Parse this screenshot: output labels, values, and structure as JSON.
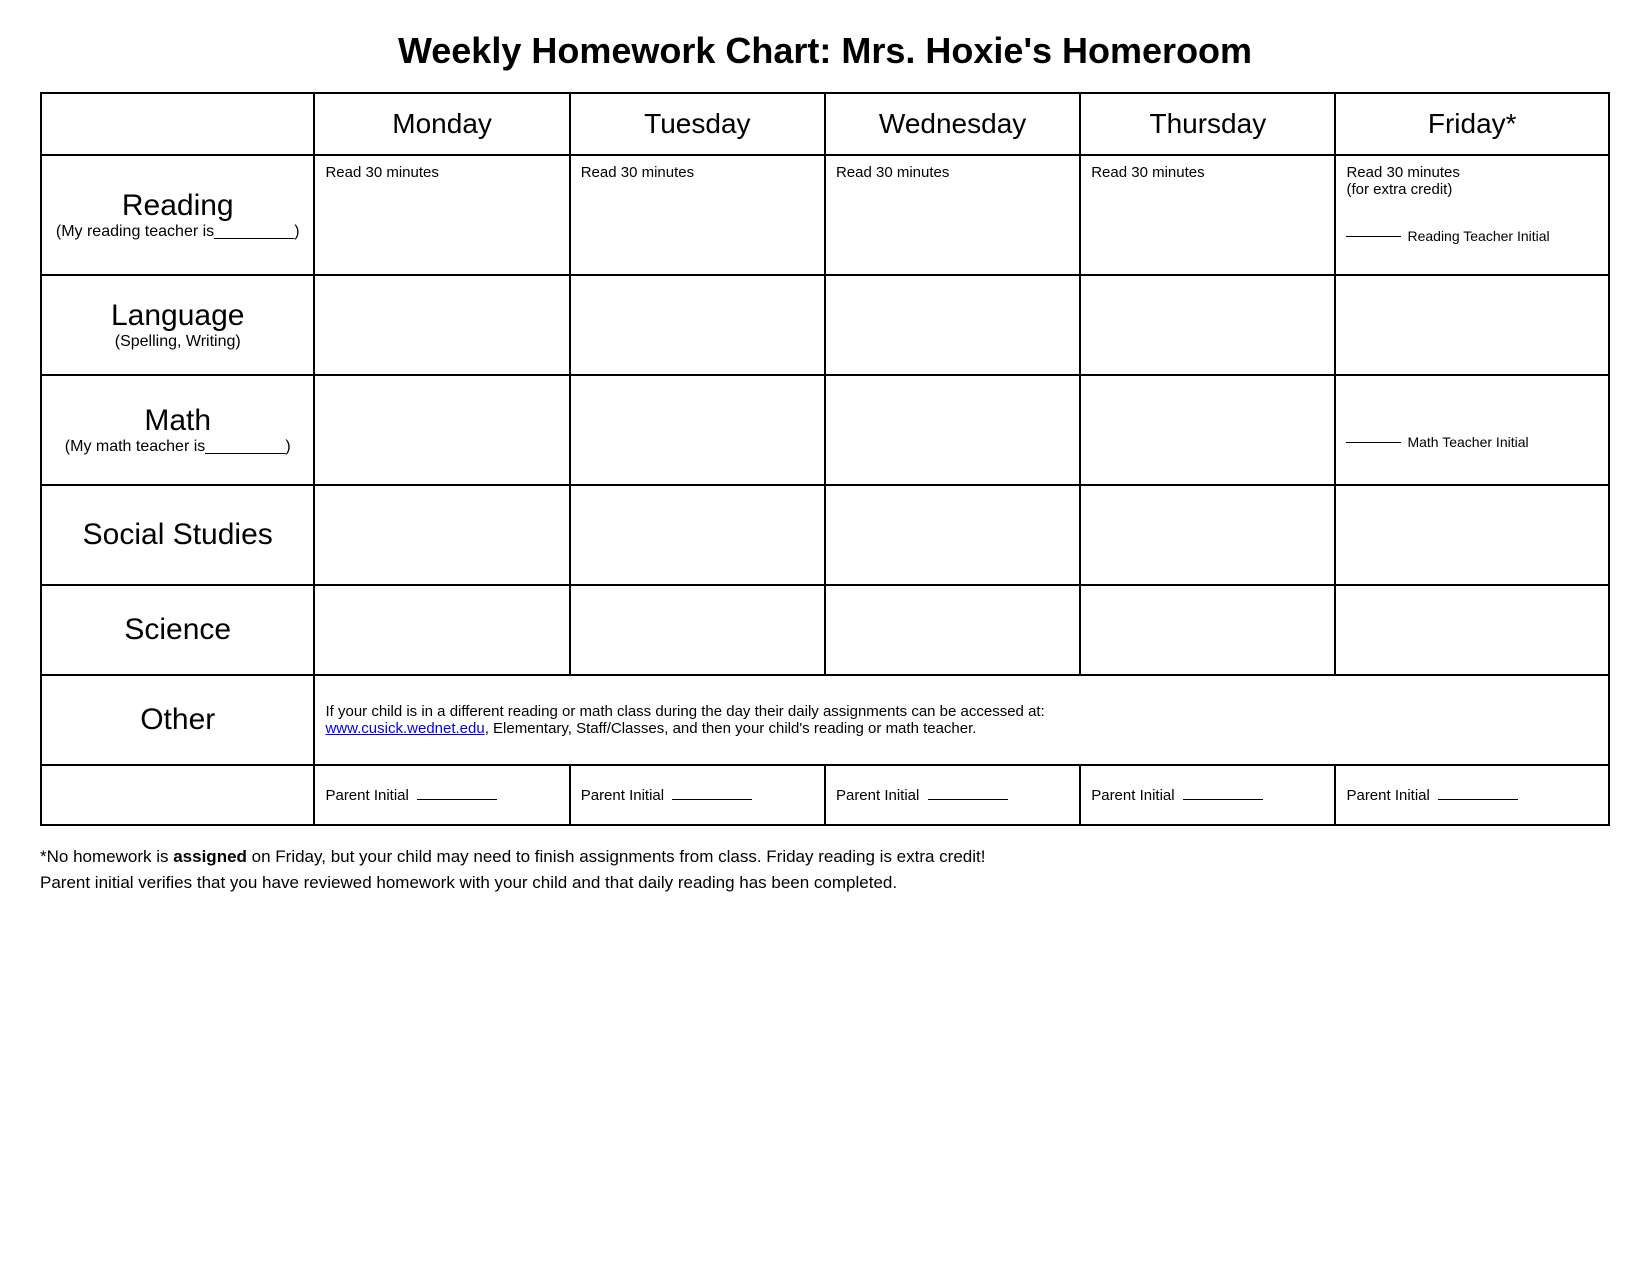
{
  "title": "Weekly Homework Chart: Mrs. Hoxie's Homeroom",
  "columns": {
    "subject": "",
    "monday": "Monday",
    "tuesday": "Tuesday",
    "wednesday": "Wednesday",
    "thursday": "Thursday",
    "friday": "Friday*"
  },
  "rows": {
    "reading": {
      "subject": "Reading",
      "sub": "(My reading teacher is_________)",
      "monday": "Read 30 minutes",
      "tuesday": "Read 30 minutes",
      "wednesday": "Read 30 minutes",
      "thursday": "Read 30 minutes",
      "friday_line1": "Read 30 minutes",
      "friday_line2": "(for extra credit)",
      "friday_teacher": "Reading Teacher Initial"
    },
    "language": {
      "subject": "Language",
      "sub": "(Spelling, Writing)"
    },
    "math": {
      "subject": "Math",
      "sub": "(My math teacher is_________)",
      "friday_teacher": "Math Teacher Initial"
    },
    "social_studies": {
      "subject": "Social Studies"
    },
    "science": {
      "subject": "Science"
    },
    "other": {
      "subject": "Other",
      "content_text": "If your child is in a different reading or math class during the day their daily assignments can be accessed at:",
      "content_link": "www.cusick.wednet.edu",
      "content_rest": ", Elementary, Staff/Classes, and then your child's reading or math teacher."
    },
    "parent_initial": {
      "monday": "Parent Initial",
      "tuesday": "Parent Initial",
      "wednesday": "Parent Initial",
      "thursday": "Parent Initial",
      "friday": "Parent Initial"
    }
  },
  "footer": {
    "text_before_bold": "*No homework is ",
    "bold_text": "assigned",
    "text_after_bold": " on Friday, but your child may need to finish assignments from class. Friday reading is extra credit!",
    "line2": "Parent initial verifies that you have reviewed homework with your child and that daily reading has been completed."
  }
}
